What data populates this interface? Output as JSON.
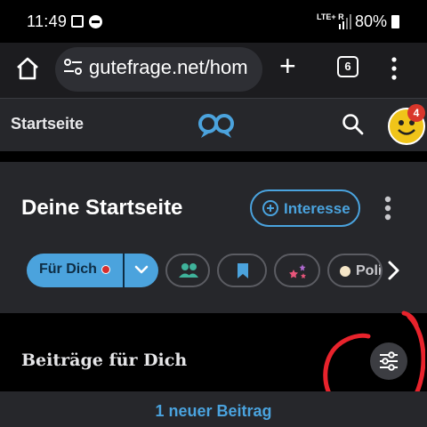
{
  "status_bar": {
    "time": "11:49",
    "network": "LTE+ R",
    "battery": "80%"
  },
  "browser": {
    "url": "gutefrage.net/hom",
    "tab_count": "6",
    "icons": [
      "home-icon",
      "site-settings-icon",
      "new-tab-icon",
      "tab-switcher-icon",
      "more-icon"
    ]
  },
  "site_header": {
    "title": "Startseite",
    "notification_count": "4",
    "icons": [
      "gutefrage-logo-icon",
      "search-icon",
      "avatar"
    ]
  },
  "card": {
    "heading": "Deine Startseite",
    "interest_button": "Interesse",
    "chips": {
      "for_you": "Für Dich",
      "politics": "Poli"
    },
    "chip_icons": [
      "users-icon",
      "bookmark-icon",
      "stars-icon",
      "chevron-right-icon"
    ]
  },
  "feed": {
    "title": "Beiträge für Dich",
    "new_posts": "1 neuer Beitrag"
  },
  "colors": {
    "accent": "#4aa3de",
    "surface": "#26272b",
    "background": "#000000",
    "annotation": "#e8232c"
  }
}
